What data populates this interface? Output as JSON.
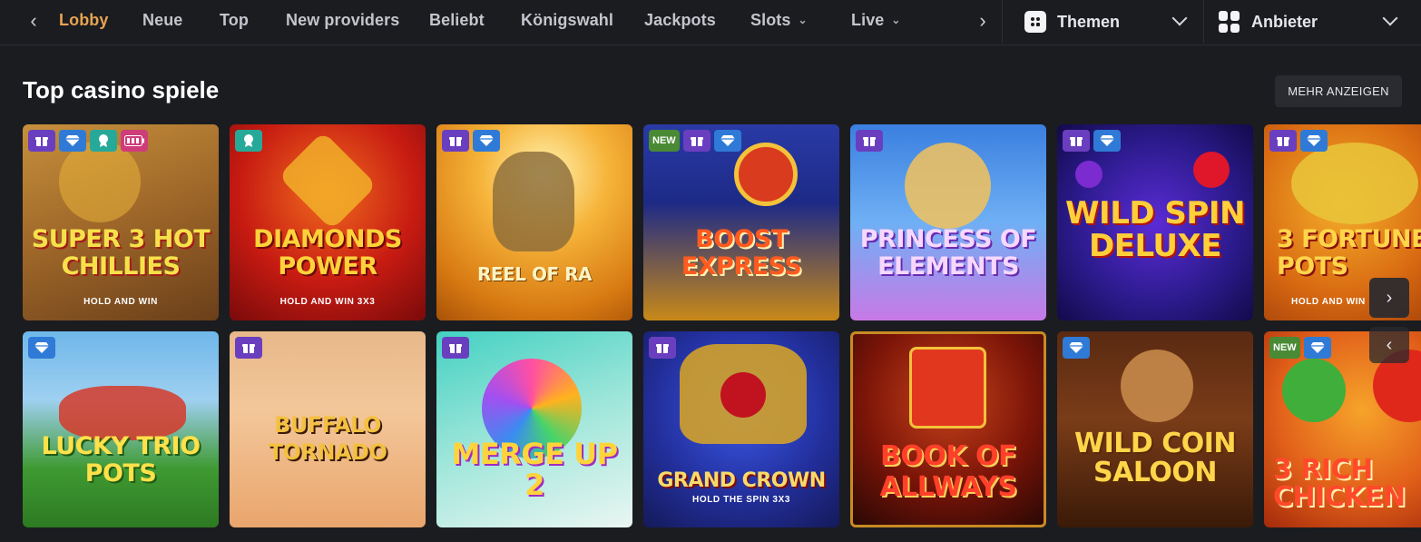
{
  "nav": {
    "prev_icon": "chevron-left-icon",
    "next_icon": "chevron-right-icon",
    "items": [
      {
        "label": "Lobby",
        "active": true
      },
      {
        "label": "Neue"
      },
      {
        "label": "Top"
      },
      {
        "label": "New providers"
      },
      {
        "label": "Beliebt"
      },
      {
        "label": "Königswahl"
      },
      {
        "label": "Jackpots"
      },
      {
        "label": "Slots",
        "dropdown": true
      },
      {
        "label": "Live",
        "dropdown": true
      }
    ],
    "themes": {
      "label": "Themen",
      "icon": "themes-icon"
    },
    "providers": {
      "label": "Anbieter",
      "icon": "grid-icon"
    }
  },
  "section": {
    "title": "Top casino spiele",
    "more_label": "MEHR ANZEIGEN"
  },
  "games_row1": [
    {
      "title": "SUPER 3 HOT CHILLIES",
      "subtitle": "HOLD AND WIN",
      "badges": [
        "gift",
        "diamond",
        "award",
        "battery"
      ]
    },
    {
      "title": "DIAMONDS POWER",
      "subtitle": "HOLD AND WIN 3X3",
      "badges": [
        "award"
      ]
    },
    {
      "title": "REEL OF RA",
      "subtitle": "",
      "badges": [
        "gift",
        "diamond"
      ]
    },
    {
      "title": "BOOST Express",
      "subtitle": "",
      "badges": [
        "new",
        "gift",
        "diamond"
      ]
    },
    {
      "title": "Princess of ELEMENTS",
      "subtitle": "",
      "badges": [
        "gift"
      ]
    },
    {
      "title": "WILD Spin Deluxe",
      "subtitle": "",
      "badges": [
        "gift",
        "diamond"
      ]
    },
    {
      "title": "3 FORTUNE POTS",
      "subtitle": "HOLD AND WIN",
      "badges": [
        "gift",
        "diamond"
      ]
    }
  ],
  "games_row2": [
    {
      "title": "LUCKY TRIO POTS",
      "subtitle": "",
      "badges": [
        "diamond"
      ]
    },
    {
      "title": "BUFFALO TORNADO",
      "subtitle": "",
      "badges": [
        "gift"
      ]
    },
    {
      "title": "MERGE UP 2",
      "subtitle": "",
      "badges": [
        "gift"
      ]
    },
    {
      "title": "GRAND CROWN",
      "subtitle": "HOLD THE SPIN 3X3",
      "badges": [
        "gift"
      ]
    },
    {
      "title": "BOOK of ALLWAYS",
      "subtitle": "",
      "badges": []
    },
    {
      "title": "WILD COIN SALOON",
      "subtitle": "",
      "badges": [
        "diamond"
      ]
    },
    {
      "title": "3 RICH CHICKEN",
      "subtitle": "",
      "badges": [
        "new",
        "diamond"
      ]
    }
  ],
  "badge_labels": {
    "new": "NEW"
  },
  "colors": {
    "accent": "#e7a451",
    "background": "#1b1c20",
    "gift_badge": "#6a3fbf",
    "diamond_badge": "#2f7ad6",
    "award_badge": "#27a99a",
    "new_badge": "#4a8a34"
  }
}
